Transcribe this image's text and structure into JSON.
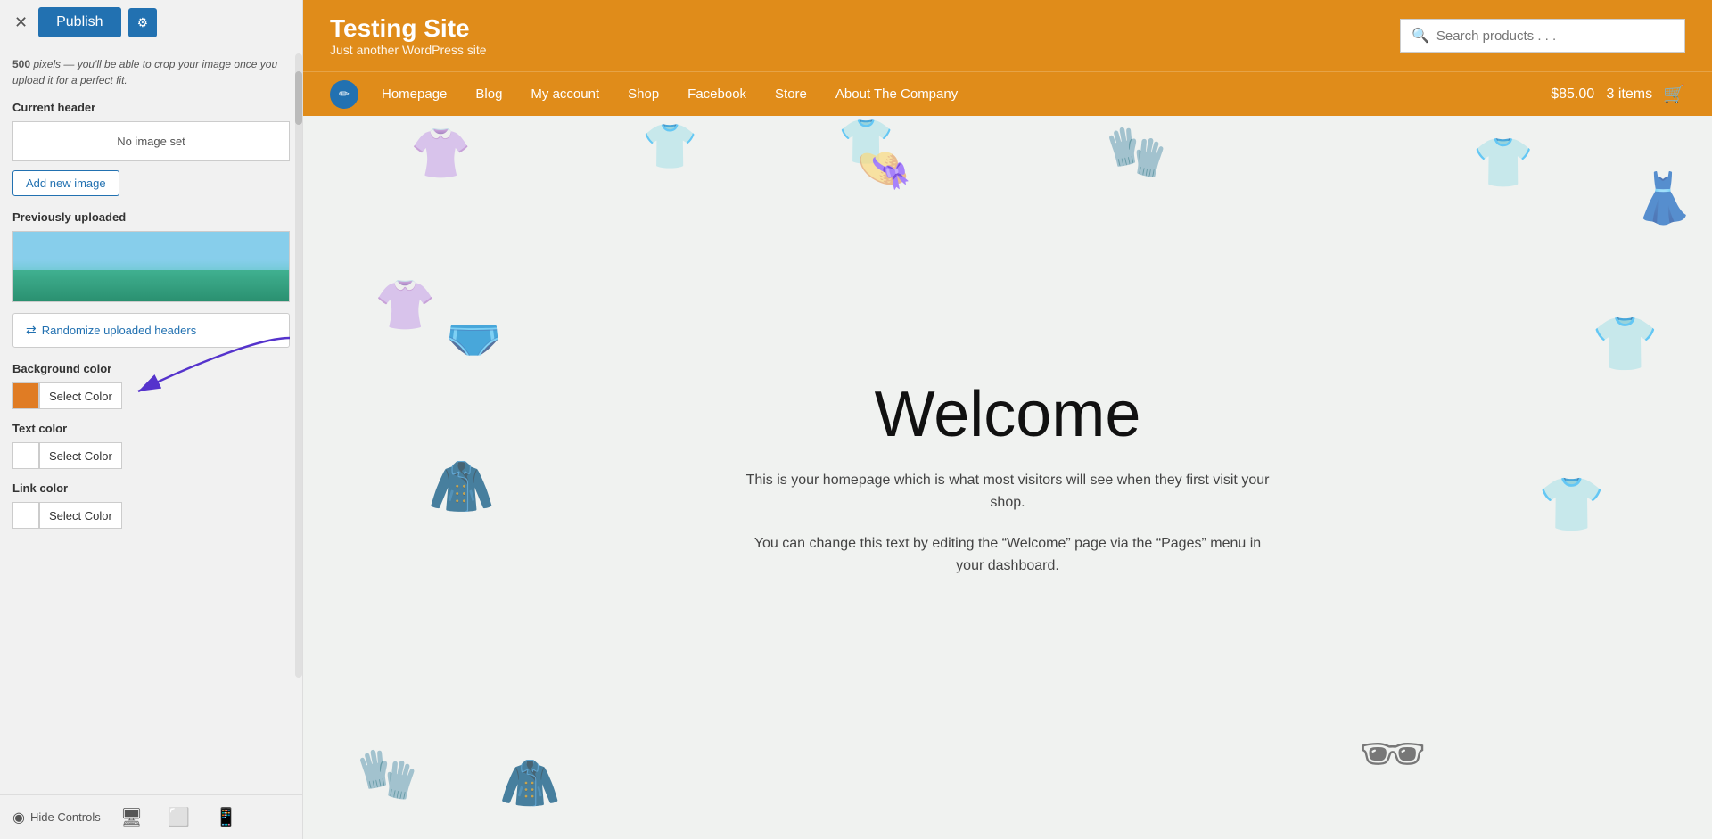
{
  "leftPanel": {
    "hintText1": "500",
    "hintText2": " pixels — you'll be able to crop your image once you upload it for a perfect fit.",
    "currentHeader": {
      "label": "Current header",
      "noImageText": "No image set"
    },
    "addImageBtn": "Add new image",
    "previouslyUploaded": "Previously uploaded",
    "randomizeBtn": "Randomize uploaded headers",
    "bgColor": {
      "label": "Background color",
      "selectLabel": "Select Color"
    },
    "textColor": {
      "label": "Text color",
      "selectLabel": "Select Color"
    },
    "linkColor": {
      "label": "Link color",
      "selectLabel": "Select Color"
    },
    "publishBtn": "Publish",
    "settingsIcon": "⚙",
    "closeIcon": "✕",
    "hideControlsBtn": "Hide Controls",
    "deviceIcons": [
      "🖥",
      "📱",
      "📱"
    ]
  },
  "siteHeader": {
    "title": "Testing Site",
    "tagline": "Just another WordPress site",
    "searchPlaceholder": "Search products . . ."
  },
  "nav": {
    "items": [
      "Homepage",
      "Blog",
      "My account",
      "Shop",
      "Facebook",
      "Store",
      "About The Company"
    ],
    "cartAmount": "$85.00",
    "cartItems": "3 items"
  },
  "welcome": {
    "title": "Welcome",
    "paragraph1": "This is your homepage which is what most visitors will see when they first visit your shop.",
    "paragraph2": "You can change this text by editing the “Welcome” page via the “Pages” menu in your dashboard."
  }
}
